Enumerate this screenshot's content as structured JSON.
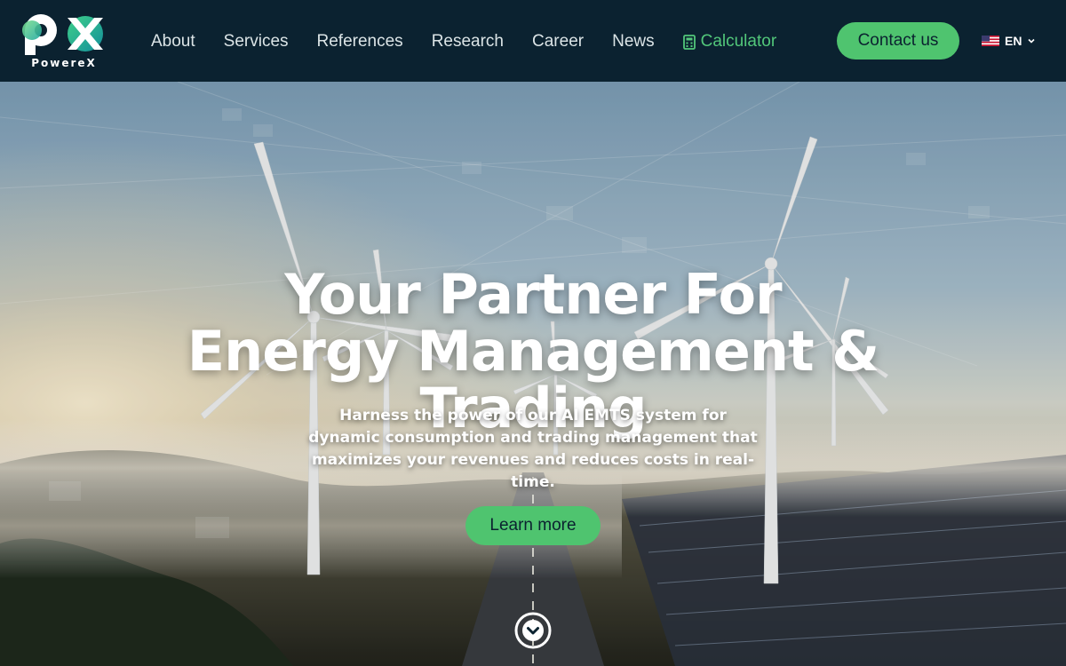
{
  "brand": {
    "name": "PowereX",
    "accent": "#4fc46f",
    "header_bg": "#0b2230"
  },
  "nav": {
    "items": [
      {
        "label": "About"
      },
      {
        "label": "Services"
      },
      {
        "label": "References"
      },
      {
        "label": "Research"
      },
      {
        "label": "Career"
      },
      {
        "label": "News"
      }
    ],
    "calculator": {
      "label": "Calculator",
      "icon": "calculator-icon"
    },
    "contact_label": "Contact us",
    "language": {
      "code": "EN",
      "flag": "us-flag-icon"
    }
  },
  "hero": {
    "title": "Your Partner For Energy Management & Trading",
    "subtitle": "Harness the power of our AI EMTS system for dynamic consumption and trading management that maximizes your revenues and reduces costs in real-time.",
    "cta_label": "Learn more",
    "scroll_icon": "chevron-down-circle-icon"
  }
}
